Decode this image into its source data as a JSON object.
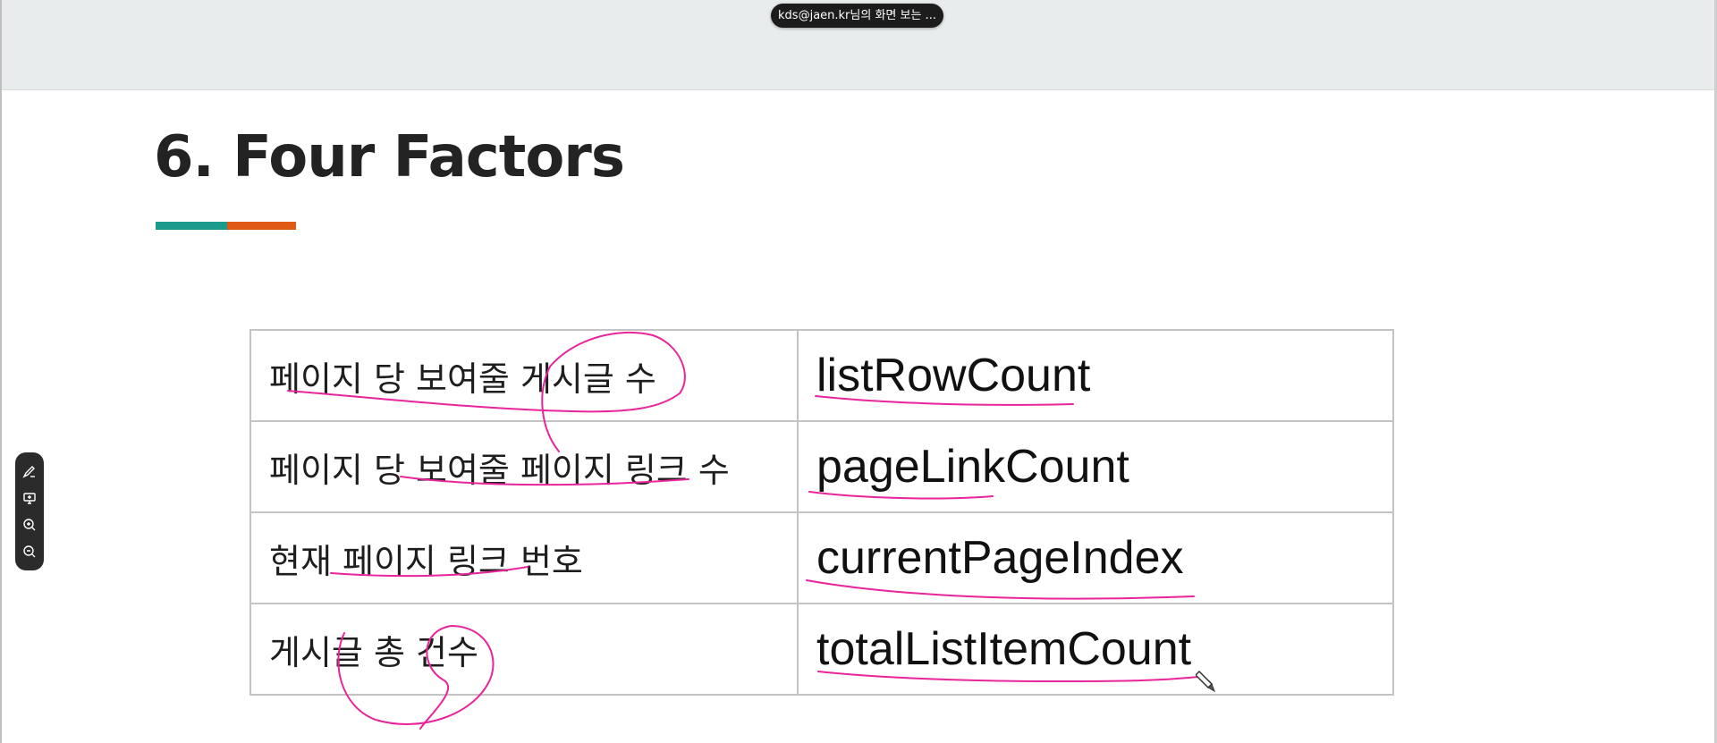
{
  "share_banner": {
    "text": "kds@jaen.kr님의 화면 보는 ..."
  },
  "slide": {
    "title": "6.  Four Factors",
    "accent_colors": [
      "#1a9a8a",
      "#e05a14"
    ],
    "table": [
      {
        "label": "페이지 당 보여줄 게시글 수",
        "variable": "listRowCount"
      },
      {
        "label": "페이지 당 보여줄 페이지 링크 수",
        "variable": "pageLinkCount"
      },
      {
        "label": "현재 페이지 링크 번호",
        "variable": "currentPageIndex"
      },
      {
        "label": "게시글 총 건수",
        "variable": "totalListItemCount"
      }
    ]
  },
  "toolbar": {
    "tools": [
      "pen-icon",
      "screen-annotate-icon",
      "zoom-in-icon",
      "zoom-out-icon"
    ]
  },
  "annotation_color": "#e8259a"
}
